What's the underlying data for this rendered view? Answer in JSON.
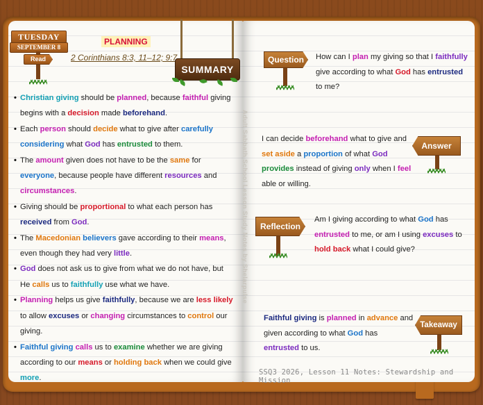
{
  "colors": {
    "navy": "#1c2a80",
    "magenta": "#c41fb1",
    "red": "#d61a2a",
    "green": "#1a8a3a",
    "orange": "#e0780e",
    "blue": "#1b74c9",
    "teal": "#14a0b4",
    "purple": "#7b2bbf"
  },
  "left_page": {
    "day": "TUESDAY",
    "date": "SEPTEMBER 8",
    "read_label": "Read",
    "title": "PLANNING",
    "scripture_ref": "2 Corinthians 8:3, 11–12; 9:7",
    "summary_label": "SUMMARY",
    "bullets": [
      [
        {
          "t": "Christian giving",
          "c": "teal"
        },
        {
          "t": " should be "
        },
        {
          "t": "planned",
          "c": "magenta"
        },
        {
          "t": ", because "
        },
        {
          "t": "faithful",
          "c": "magenta"
        },
        {
          "t": " giving begins with a "
        },
        {
          "t": "decision",
          "c": "red"
        },
        {
          "t": " made "
        },
        {
          "t": "beforehand",
          "c": "navy"
        },
        {
          "t": "."
        }
      ],
      [
        {
          "t": "Each "
        },
        {
          "t": "person",
          "c": "magenta"
        },
        {
          "t": " should "
        },
        {
          "t": "decide",
          "c": "orange"
        },
        {
          "t": " what to give after "
        },
        {
          "t": "carefully considering",
          "c": "blue"
        },
        {
          "t": " what "
        },
        {
          "t": "God",
          "c": "purple"
        },
        {
          "t": " has "
        },
        {
          "t": "entrusted",
          "c": "green"
        },
        {
          "t": " to them."
        }
      ],
      [
        {
          "t": "The "
        },
        {
          "t": "amount",
          "c": "magenta"
        },
        {
          "t": " given does not have to be the "
        },
        {
          "t": "same",
          "c": "orange"
        },
        {
          "t": " for "
        },
        {
          "t": "everyone",
          "c": "blue"
        },
        {
          "t": ", because people have different "
        },
        {
          "t": "resources",
          "c": "purple"
        },
        {
          "t": " and "
        },
        {
          "t": "circumstances",
          "c": "magenta"
        },
        {
          "t": "."
        }
      ],
      [
        {
          "t": "Giving should be "
        },
        {
          "t": "proportional",
          "c": "red"
        },
        {
          "t": " to what each person has "
        },
        {
          "t": "received",
          "c": "navy"
        },
        {
          "t": " from "
        },
        {
          "t": "God",
          "c": "purple"
        },
        {
          "t": "."
        }
      ],
      [
        {
          "t": "The "
        },
        {
          "t": "Macedonian",
          "c": "orange"
        },
        {
          "t": " "
        },
        {
          "t": "believers",
          "c": "blue"
        },
        {
          "t": " gave according to their "
        },
        {
          "t": "means",
          "c": "magenta"
        },
        {
          "t": ", even though they had very "
        },
        {
          "t": "little",
          "c": "purple"
        },
        {
          "t": "."
        }
      ],
      [
        {
          "t": "God",
          "c": "purple"
        },
        {
          "t": " does not ask us to give from what we do not have, but He "
        },
        {
          "t": "calls",
          "c": "orange"
        },
        {
          "t": " us to "
        },
        {
          "t": "faithfully",
          "c": "teal"
        },
        {
          "t": " use what we have."
        }
      ],
      [
        {
          "t": "Planning",
          "c": "magenta"
        },
        {
          "t": " helps us give "
        },
        {
          "t": "faithfully",
          "c": "navy"
        },
        {
          "t": ", because we are "
        },
        {
          "t": "less likely",
          "c": "red"
        },
        {
          "t": " to allow "
        },
        {
          "t": "excuses",
          "c": "navy"
        },
        {
          "t": " or "
        },
        {
          "t": "changing",
          "c": "magenta"
        },
        {
          "t": " circumstances to "
        },
        {
          "t": "control",
          "c": "orange"
        },
        {
          "t": " our giving."
        }
      ],
      [
        {
          "t": "Faithful giving",
          "c": "blue"
        },
        {
          "t": " "
        },
        {
          "t": "calls",
          "c": "magenta"
        },
        {
          "t": " us to "
        },
        {
          "t": "examine",
          "c": "green"
        },
        {
          "t": " whether we are giving according to our "
        },
        {
          "t": "means",
          "c": "red"
        },
        {
          "t": " or "
        },
        {
          "t": "holding back",
          "c": "orange"
        },
        {
          "t": " when we could give "
        },
        {
          "t": "more",
          "c": "teal"
        },
        {
          "t": "."
        }
      ]
    ]
  },
  "spine_text": "Adult Sabbath School Lesson Study Notes by Shelarpulse",
  "right_page": {
    "question": {
      "label": "Question",
      "text": [
        {
          "t": "How can I "
        },
        {
          "t": "plan",
          "c": "magenta"
        },
        {
          "t": " my giving so that I "
        },
        {
          "t": "faithfully",
          "c": "purple"
        },
        {
          "t": " give according to what "
        },
        {
          "t": "God",
          "c": "red"
        },
        {
          "t": " has "
        },
        {
          "t": "entrusted",
          "c": "navy"
        },
        {
          "t": " to me?"
        }
      ]
    },
    "answer": {
      "label": "Answer",
      "text": [
        {
          "t": "I can decide "
        },
        {
          "t": "beforehand",
          "c": "magenta"
        },
        {
          "t": " what to give and "
        },
        {
          "t": "set aside",
          "c": "orange"
        },
        {
          "t": " a "
        },
        {
          "t": "proportion",
          "c": "blue"
        },
        {
          "t": " of what "
        },
        {
          "t": "God",
          "c": "purple"
        },
        {
          "t": " "
        },
        {
          "t": "provides",
          "c": "green"
        },
        {
          "t": " instead of giving "
        },
        {
          "t": "only",
          "c": "purple"
        },
        {
          "t": " when I "
        },
        {
          "t": "feel",
          "c": "magenta"
        },
        {
          "t": " able or willing."
        }
      ]
    },
    "reflection": {
      "label": "Reflection",
      "text": [
        {
          "t": "Am I giving according to what "
        },
        {
          "t": "God",
          "c": "blue"
        },
        {
          "t": " has "
        },
        {
          "t": "entrusted",
          "c": "magenta"
        },
        {
          "t": " to me, or am I using "
        },
        {
          "t": "excuses",
          "c": "purple"
        },
        {
          "t": " to "
        },
        {
          "t": "hold back",
          "c": "red"
        },
        {
          "t": " what I could give?"
        }
      ]
    },
    "takeaway": {
      "label": "Takeaway",
      "text": [
        {
          "t": "Faithful giving",
          "c": "navy"
        },
        {
          "t": " is "
        },
        {
          "t": "planned",
          "c": "magenta"
        },
        {
          "t": " in "
        },
        {
          "t": "advance",
          "c": "orange"
        },
        {
          "t": " and given according to what "
        },
        {
          "t": "God",
          "c": "blue"
        },
        {
          "t": " has "
        },
        {
          "t": "entrusted",
          "c": "purple"
        },
        {
          "t": " to us."
        }
      ]
    },
    "footer": "SSQ3 2026, Lesson 11 Notes: Stewardship and Mission"
  }
}
